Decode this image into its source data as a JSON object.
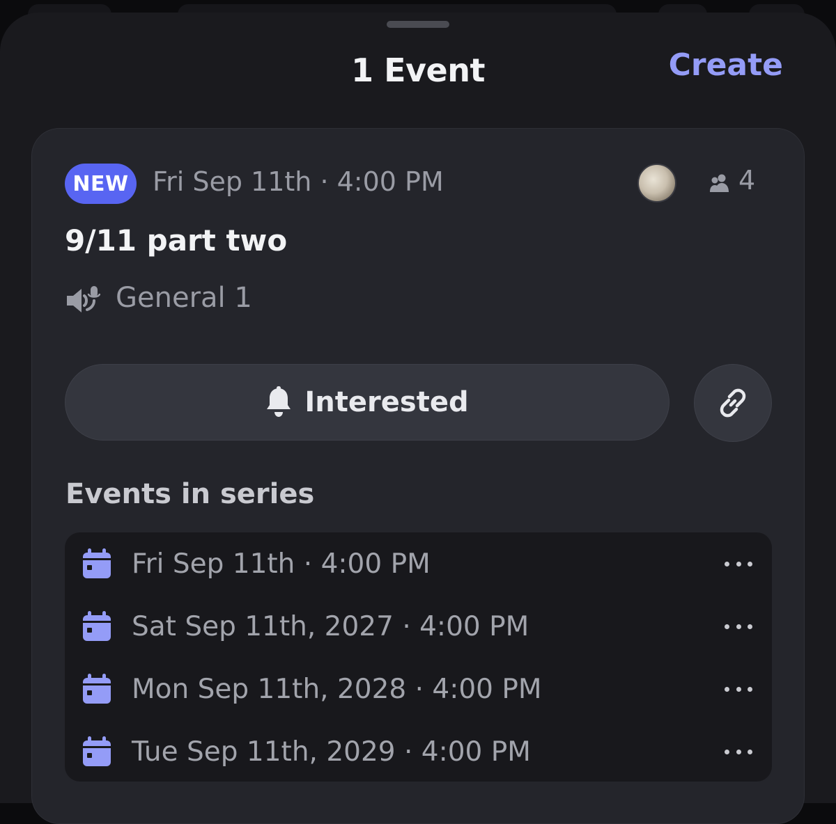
{
  "header": {
    "title": "1 Event",
    "create_label": "Create"
  },
  "event": {
    "badge": "NEW",
    "time": "Fri Sep 11th · 4:00 PM",
    "interested_count": "4",
    "title": "9/11 part two",
    "channel": "General 1",
    "interested_label": "Interested"
  },
  "series": {
    "heading": "Events in series",
    "items": [
      {
        "date": "Fri Sep 11th · 4:00 PM"
      },
      {
        "date": "Sat Sep 11th, 2027 · 4:00 PM"
      },
      {
        "date": "Mon Sep 11th, 2028 · 4:00 PM"
      },
      {
        "date": "Tue Sep 11th, 2029 · 4:00 PM"
      }
    ]
  },
  "colors": {
    "accent": "#5865f2",
    "create": "#949cf7",
    "calendar_icon": "#949cf7",
    "sheet_bg": "#1a1a1e",
    "card_bg": "#24252b"
  },
  "icons": {
    "people": "people-icon",
    "stage": "stage-channel-icon",
    "bell": "bell-icon",
    "link": "link-icon",
    "calendar": "calendar-icon",
    "more": "more-icon"
  }
}
